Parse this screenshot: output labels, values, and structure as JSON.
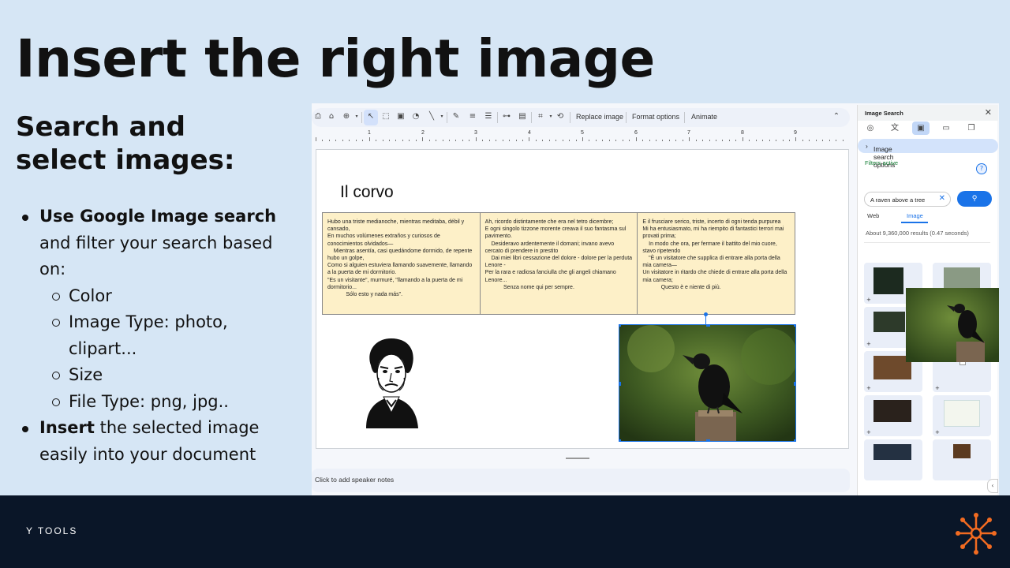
{
  "title": "Insert the right image",
  "subtitle": "Search and select images:",
  "bullets": {
    "b1_bold": "Use Google Image search",
    "b1_rest": " and filter your search based on:",
    "sub": [
      "Color",
      "Image Type: photo, clipart...",
      "Size",
      "File Type: png, jpg.."
    ],
    "b2_bold": "Insert",
    "b2_rest": " the selected image easily into your document"
  },
  "toolbar": {
    "replace_image": "Replace image",
    "format_options": "Format options",
    "animate": "Animate"
  },
  "ruler": [
    "1",
    "2",
    "3",
    "4",
    "5",
    "6",
    "7",
    "8",
    "9"
  ],
  "slide": {
    "title": "Il corvo",
    "poem_col1": [
      "Hubo una triste medianoche, mientras meditaba, débil y cansado,",
      "En muchos volúmenes extraños y curiosos de conocimientos olvidados—",
      "    Mientras asentía, casi quedándome dormido, de repente hubo un golpe,",
      "Como si alguien estuviera llamando suavemente, llamando a la puerta de mi dormitorio.",
      "\"Es un visitante\", murmuré, \"llamando a la puerta de mi dormitorio...",
      "            Sólo esto y nada más\"."
    ],
    "poem_col2": [
      "Ah, ricordo distintamente che era nel tetro dicembre;",
      "E ogni singolo tizzone morente creava il suo fantasma sul pavimento.",
      "    Desideravo ardentemente il domani; invano avevo cercato di prendere in prestito",
      "    Dai miei libri cessazione del dolore - dolore per la perduta Lenore -",
      "Per la rara e radiosa fanciulla che gli angeli chiamano Lenore...",
      "            Senza nome qui per sempre."
    ],
    "poem_col3": [
      "E il frusciare serico, triste, incerto di ogni tenda purpurea",
      "Mi ha entusiasmato, mi ha riempito di fantastici terrori mai provati prima;",
      "    In modo che ora, per fermare il battito del mio cuore, stavo ripetendo",
      "    \"È un visitatore che supplica di entrare alla porta della mia camera—",
      "Un visitatore in ritardo che chiede di entrare alla porta della mia camera;",
      "            Questo è e niente di più."
    ]
  },
  "notes": "Click to add speaker notes",
  "panel": {
    "title": "Image Search",
    "options": "Image search options",
    "filters": "Filters active",
    "query": "A raven above a tree",
    "tab_web": "Web",
    "tab_image": "Image",
    "results": "About 9,360,000 results (0.47 seconds)"
  },
  "footer": {
    "brand": "Y TOOLS"
  },
  "colors": {
    "background": "#d6e6f5",
    "footer": "#0a1628",
    "accent": "#1a73e8",
    "poem_bg": "#fdf0c8",
    "logo": "#f26b21"
  }
}
